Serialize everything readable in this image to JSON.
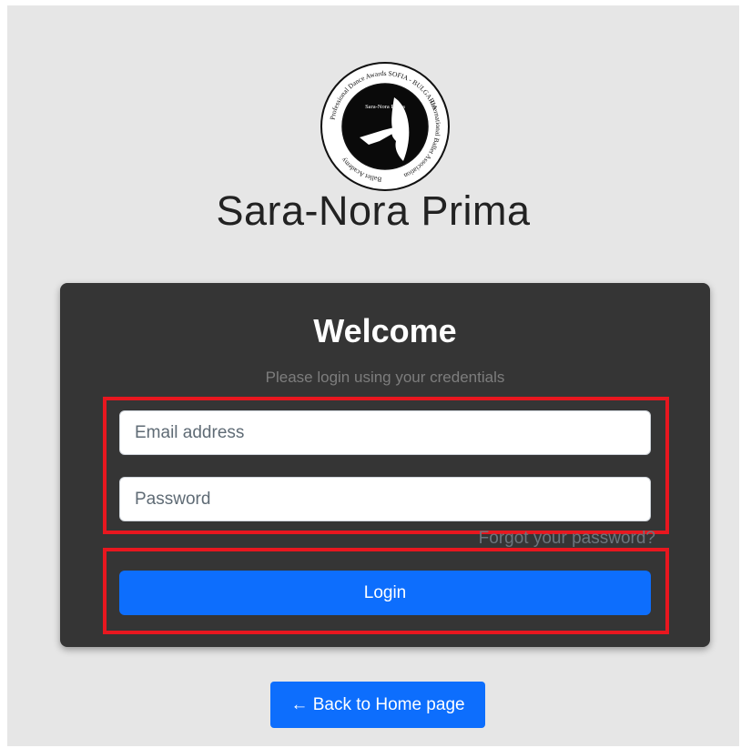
{
  "logo": {
    "icon": "academy-seal-logo",
    "ring_text_top": "SOFIA - BULGARIA",
    "ring_text_right": "International Ballet Association",
    "ring_text_bottom": "Ballet Academy",
    "ring_text_left": "Professional Dance Awards",
    "inner_text": "Sara-Nora Prima"
  },
  "site_title": "Sara-Nora Prima",
  "card": {
    "welcome": "Welcome",
    "subtitle": "Please login using your credentials",
    "email_placeholder": "Email address",
    "password_placeholder": "Password",
    "forgot_password": "Forgot your password?",
    "login_label": "Login"
  },
  "back_button_label": "← Back to Home page",
  "colors": {
    "page_background": "#e6e6e6",
    "card_background": "#353535",
    "primary_button": "#0d6efd",
    "highlight_border": "#e8171f"
  }
}
